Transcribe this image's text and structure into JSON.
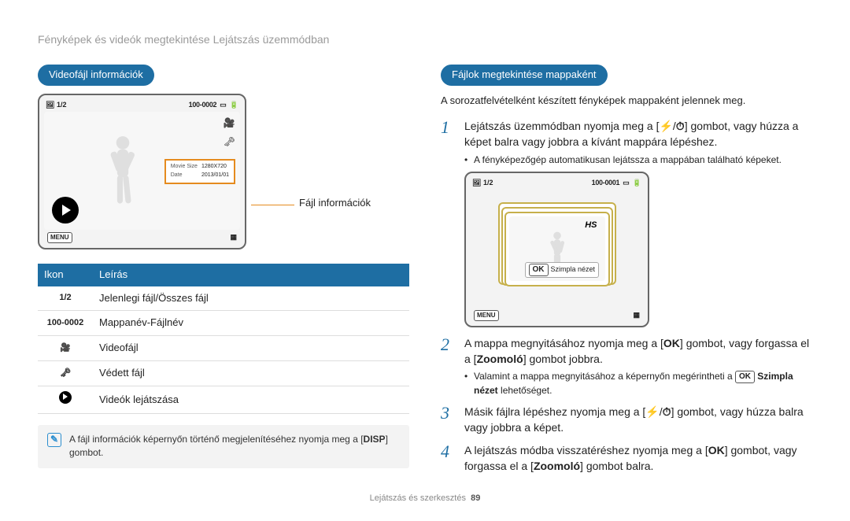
{
  "header": "Fényképek és videók megtekintése Lejátszás üzemmódban",
  "left": {
    "pill": "Videofájl információk",
    "info_label": "Fájl információk",
    "cam": {
      "top_left": "1/2",
      "top_right_folder": "100-0002",
      "menu": "MENU",
      "info_rows": [
        {
          "k": "Movie Size",
          "v": "1280X720"
        },
        {
          "k": "Date",
          "v": "2013/01/01"
        }
      ]
    },
    "table": {
      "h1": "Ikon",
      "h2": "Leírás",
      "rows": [
        {
          "icon": "1/2",
          "desc": "Jelenlegi fájl/Összes fájl"
        },
        {
          "icon": "100-0002",
          "desc": "Mappanév-Fájlnév"
        },
        {
          "icon": "video-icon",
          "desc": "Videofájl"
        },
        {
          "icon": "lock-icon",
          "desc": "Védett fájl"
        },
        {
          "icon": "play-icon",
          "desc": "Videók lejátszása"
        }
      ]
    },
    "note": "A fájl információk képernyőn történő megjelenítéséhez nyomja meg a",
    "note_btn": "DISP",
    "note_tail": " gombot."
  },
  "right": {
    "pill": "Fájlok megtekintése mappaként",
    "intro": "A sorozatfelvételként készített fényképek mappaként jelennek meg.",
    "steps": [
      {
        "n": "1",
        "text_parts": [
          "Lejátszás üzemmódban nyomja meg a [",
          "/",
          "] gombot, vagy húzza a képet balra vagy jobbra a kívánt mappára lépéshez."
        ],
        "sub": "A fényképezőgép automatikusan lejátssza a mappában található képeket."
      },
      {
        "n": "2",
        "text_parts": [
          "A mappa megnyitásához nyomja meg a [",
          "] gombot, vagy forgassa el a [",
          "Zoomoló",
          "] gombot jobbra."
        ],
        "sub_parts": [
          "Valamint a mappa megnyitásához a képernyőn megérintheti a ",
          " Szimpla nézet",
          " lehetőséget."
        ]
      },
      {
        "n": "3",
        "text_parts": [
          "Másik fájlra lépéshez nyomja meg a [",
          "/",
          "] gombot, vagy húzza balra vagy jobbra a képet."
        ]
      },
      {
        "n": "4",
        "text_parts": [
          "A lejátszás módba visszatéréshez nyomja meg a [",
          "] gombot, vagy forgassa el a [",
          "Zoomoló",
          "] gombot balra."
        ]
      }
    ],
    "cam2": {
      "top_left": "1/2",
      "top_right_folder": "100-0001",
      "menu": "MENU",
      "ok": "OK",
      "ok_text": "Szimpla nézet",
      "hs": "HS"
    }
  },
  "glyphs": {
    "flash": "⚡",
    "timer": "⏱",
    "ok": "OK",
    "ok_badge": "OK"
  },
  "footer": {
    "text": "Lejátszás és szerkesztés",
    "page": "89"
  }
}
